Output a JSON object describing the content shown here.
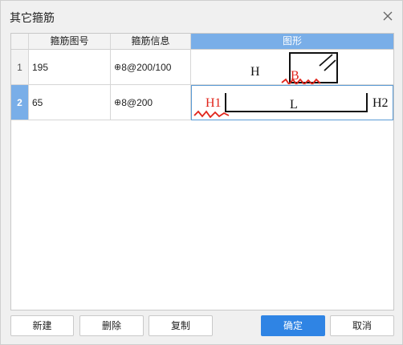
{
  "window": {
    "title": "其它箍筋"
  },
  "icons": {
    "close": "close-icon",
    "rebar_grade": "hrb400-grade-icon"
  },
  "colors": {
    "accent": "#2f84e4",
    "header_selected": "#79aee8",
    "annotation": "#e0241b"
  },
  "table": {
    "columns": [
      "箍筋图号",
      "箍筋信息",
      "图形"
    ],
    "rows": [
      {
        "index": "1",
        "figure_no": "195",
        "info_symbol": "⊕",
        "info": "8@200/100",
        "shape_labels": {
          "h": "H",
          "b": "B"
        }
      },
      {
        "index": "2",
        "figure_no": "65",
        "info_symbol": "⊕",
        "info": "8@200",
        "shape_labels": {
          "h1": "H1",
          "l": "L",
          "h2": "H2"
        }
      }
    ],
    "selected_row": 2
  },
  "buttons": {
    "new": "新建",
    "delete": "删除",
    "copy": "复制",
    "ok": "确定",
    "cancel": "取消"
  }
}
